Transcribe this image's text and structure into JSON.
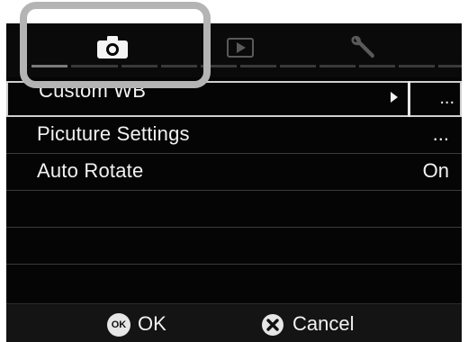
{
  "tabs": [
    {
      "name": "camera",
      "icon": "camera-icon",
      "active": true
    },
    {
      "name": "playback",
      "icon": "playback-icon",
      "active": false
    },
    {
      "name": "settings",
      "icon": "wrench-icon",
      "active": false
    }
  ],
  "menu": {
    "items": [
      {
        "label": "Custom WB",
        "value": "...",
        "selected": true
      },
      {
        "label": "Picuture Settings",
        "value": "..."
      },
      {
        "label": "Auto Rotate",
        "value": "On"
      }
    ]
  },
  "footer": {
    "ok_badge": "OK",
    "ok_label": "OK",
    "cancel_label": "Cancel"
  },
  "colors": {
    "background": "#050505",
    "text": "#f2f2f2",
    "highlight_frame": "#b4b4b4"
  }
}
